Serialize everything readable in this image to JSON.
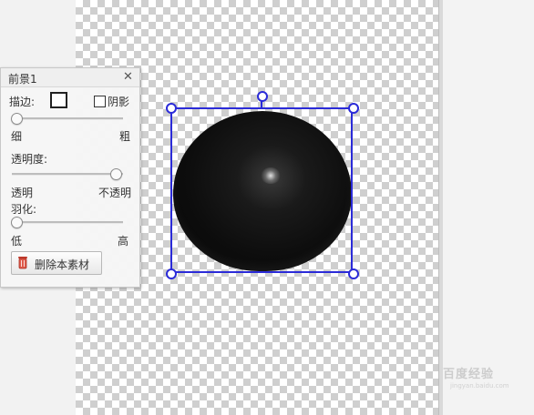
{
  "panel": {
    "title": "前景1",
    "close": "✕",
    "stroke_label": "描边:",
    "shadow_label": "阴影",
    "shadow_checked": false,
    "stroke_slider": {
      "value": 0,
      "min_label": "细",
      "max_label": "粗"
    },
    "opacity": {
      "label": "透明度:",
      "value": 1.0,
      "min_label": "透明",
      "max_label": "不透明"
    },
    "feather": {
      "label": "羽化:",
      "value": 0,
      "min_label": "低",
      "max_label": "高"
    },
    "delete_button": "删除本素材"
  },
  "colors": {
    "selection": "#2b2bd8",
    "checker": "#cfcfcf"
  },
  "watermark": {
    "text": "百度经验",
    "sub": "jingyan.baidu.com"
  }
}
